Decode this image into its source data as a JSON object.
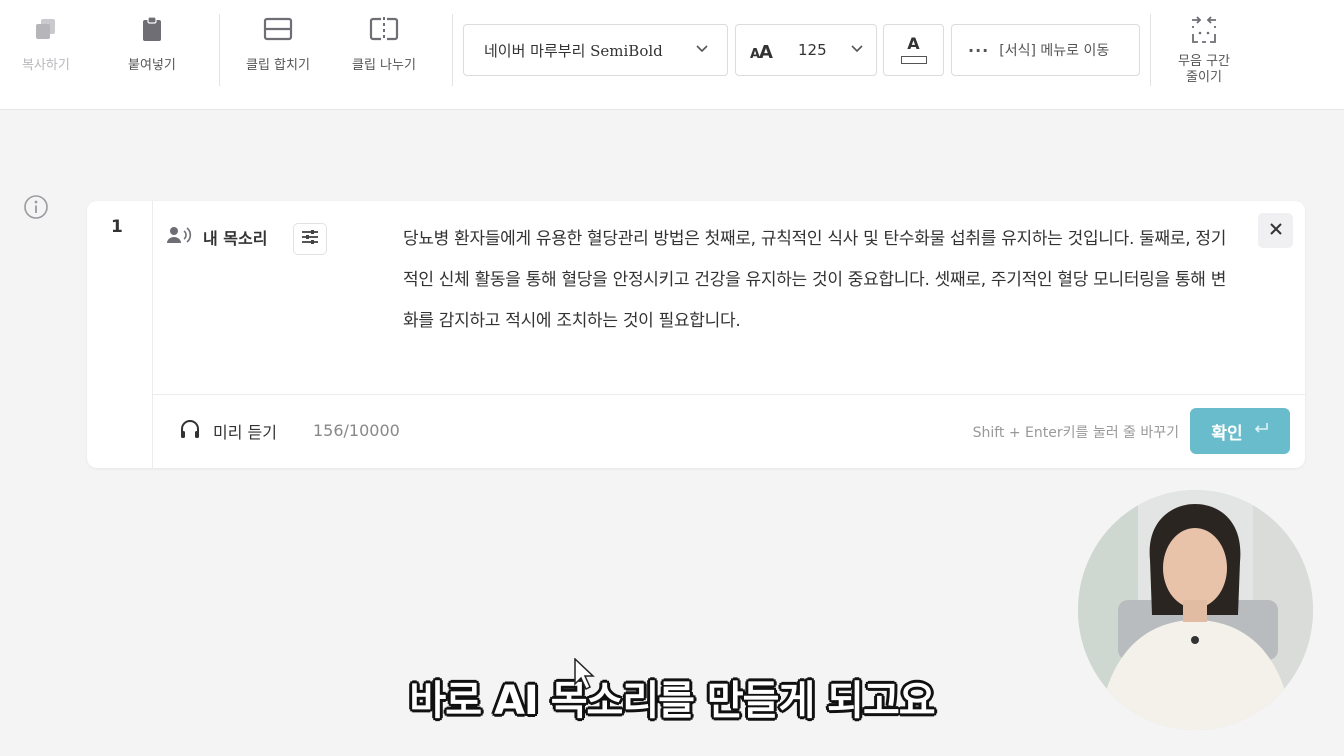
{
  "toolbar": {
    "copy_label": "복사하기",
    "paste_label": "붙여넣기",
    "merge_label": "클립 합치기",
    "split_label": "클립 나누기",
    "font_name": "네이버 마루부리 SemiBold",
    "font_size": "125",
    "text_color_glyph": "A",
    "more_label": "[서식] 메뉴로 이동",
    "silence_label_line1": "무음 구간",
    "silence_label_line2": "줄이기"
  },
  "clip": {
    "index": "1",
    "voice_name": "내 목소리",
    "script_text": "당뇨병 환자들에게 유용한 혈당관리 방법은 첫째로, 규칙적인 식사 및 탄수화물 섭취를 유지하는 것입니다. 둘째로, 정기적인 신체 활동을 통해 혈당을 안정시키고 건강을 유지하는 것이 중요합니다. 셋째로, 주기적인 혈당 모니터링을 통해 변화를 감지하고 적시에 조치하는 것이 필요합니다.",
    "preview_label": "미리 듣기",
    "char_count": "156/10000",
    "hint": "Shift + Enter키를 눌러 줄 바꾸기",
    "confirm_label": "확인"
  },
  "subtitle": "바로 AI 목소리를 만들게 되고요",
  "colors": {
    "accent": "#69bccc",
    "background": "#f4f4f5"
  },
  "icons": [
    "copy-icon",
    "clipboard-icon",
    "merge-icon",
    "split-icon",
    "chevron-down-icon",
    "font-size-icon",
    "text-color-icon",
    "more-icon",
    "shrink-silence-icon",
    "info-icon",
    "voice-icon",
    "settings-sliders-icon",
    "close-icon",
    "headphones-icon",
    "enter-icon"
  ]
}
